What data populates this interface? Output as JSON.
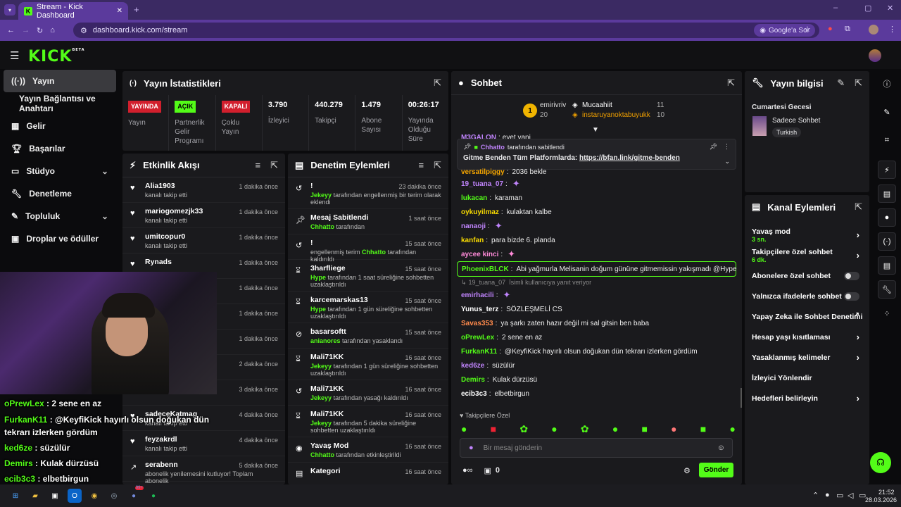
{
  "browser": {
    "tab_title": "Stream - Kick Dashboard",
    "url": "dashboard.kick.com/stream",
    "google_btn": "Google'a Sor"
  },
  "brand": {
    "logo": "KICK",
    "beta": "BETA",
    "accent": "#53fc18"
  },
  "sidebar": {
    "items": [
      {
        "label": "Yayın"
      },
      {
        "label": "Yayın Bağlantısı ve Anahtarı"
      },
      {
        "label": "Gelir"
      },
      {
        "label": "Başarılar"
      },
      {
        "label": "Stüdyo"
      },
      {
        "label": "Denetleme"
      },
      {
        "label": "Topluluk"
      },
      {
        "label": "Droplar ve ödüller"
      }
    ]
  },
  "stats": {
    "title": "Yayın İstatistikleri",
    "cells": [
      {
        "tag": "YAYINDA",
        "label": "Yayın"
      },
      {
        "tag": "AÇIK",
        "label": "Partnerlik Gelir Programı"
      },
      {
        "tag": "KAPALI",
        "label": "Çoklu Yayın"
      },
      {
        "value": "3.790",
        "label": "İzleyici"
      },
      {
        "value": "440.279",
        "label": "Takipçi"
      },
      {
        "value": "1.479",
        "label": "Abone Sayısı"
      },
      {
        "value": "00:26:17",
        "label": "Yayında Olduğu Süre"
      }
    ]
  },
  "activity": {
    "title": "Etkinlik Akışı",
    "items": [
      {
        "name": "Alia1903",
        "sub": "kanalı takip etti",
        "time": "1 dakika önce"
      },
      {
        "name": "mariogomezjk33",
        "sub": "kanalı takip etti",
        "time": "1 dakika önce"
      },
      {
        "name": "umitcopur0",
        "sub": "kanalı takip etti",
        "time": "1 dakika önce"
      },
      {
        "name": "Rynads",
        "sub": "",
        "time": "1 dakika önce"
      },
      {
        "name": "",
        "sub": "",
        "time": "1 dakika önce"
      },
      {
        "name": "",
        "sub": "",
        "time": "1 dakika önce"
      },
      {
        "name": "",
        "sub": "",
        "time": "1 dakika önce"
      },
      {
        "name": "",
        "sub": "",
        "time": "2 dakika önce"
      },
      {
        "name": "",
        "sub": "kanalı takip etti",
        "time": "3 dakika önce"
      },
      {
        "name": "sadeceKatmag",
        "sub": "kanalı takip etti",
        "time": "4 dakika önce"
      },
      {
        "name": "feyzakrdl",
        "sub": "kanalı takip etti",
        "time": "4 dakika önce"
      },
      {
        "name": "serabenn",
        "sub": "abonelik yenilemesini kutluyor! Toplam abonelik",
        "time": "5 dakika önce"
      }
    ]
  },
  "moderation": {
    "title": "Denetim Eylemleri",
    "items": [
      {
        "name": "!",
        "hl": "Jekeyy",
        "sub": "tarafından engellenmiş bir terim olarak eklendi",
        "time": "23 dakika önce"
      },
      {
        "name": "Mesaj Sabitlendi",
        "hl": "Chhatto",
        "sub": "tarafından",
        "time": "1 saat önce"
      },
      {
        "name": "!",
        "hl": "Chhatto",
        "pre": "engellenmiş terim",
        "sub": "tarafından kaldırıldı",
        "time": "15 saat önce"
      },
      {
        "name": "3harfliege",
        "hl": "Hype",
        "sub": "tarafından 1 saat süreliğine sohbetten uzaklaştırıldı",
        "time": "15 saat önce"
      },
      {
        "name": "karcemarskas13",
        "hl": "Hype",
        "sub": "tarafından 1 gün süreliğine sohbetten uzaklaştırıldı",
        "time": "15 saat önce"
      },
      {
        "name": "basarsoftt",
        "hl": "anianores",
        "sub": "tarafından yasaklandı",
        "time": "15 saat önce"
      },
      {
        "name": "Mali71KK",
        "hl": "Jekeyy",
        "sub": "tarafından 1 gün süreliğine sohbetten uzaklaştırıldı",
        "time": "16 saat önce"
      },
      {
        "name": "Mali71KK",
        "hl": "Jekeyy",
        "sub": "tarafından yasağı kaldırıldı",
        "time": "16 saat önce"
      },
      {
        "name": "Mali71KK",
        "hl": "Jekeyy",
        "sub": "tarafından 5 dakika süreliğine sohbetten uzaklaştırıldı",
        "time": "16 saat önce"
      },
      {
        "name": "Yavaş Mod",
        "hl": "Chhatto",
        "sub": "tarafından etkinleştirildi",
        "time": "16 saat önce"
      },
      {
        "name": "Kategori",
        "hl": "",
        "sub": "",
        "time": "16 saat önce"
      }
    ]
  },
  "chat": {
    "title": "Sohbet",
    "top": [
      {
        "rank": "1",
        "name": "emirivriv",
        "count": "20"
      },
      {
        "name": "Mucaahiit",
        "count": "11"
      },
      {
        "name": "instaruyanoktabuyukk",
        "count": "10"
      }
    ],
    "first_line": {
      "user": "M3GALON",
      "text": "evet yani"
    },
    "pinned": {
      "by": "Chhatto",
      "by_suffix": "tarafından sabitlendi",
      "text": "Gitme Benden Tüm Platformlarda:",
      "link": "https://bfan.link/gitme-benden"
    },
    "messages": [
      {
        "user": "versatilpiggy",
        "text": "2036 bekle",
        "color": "#f7a700"
      },
      {
        "user": "19_tuana_07",
        "text": "",
        "color": "#c084fc"
      },
      {
        "user": "lukacan",
        "text": "karaman",
        "color": "#53fc18"
      },
      {
        "user": "oykuyilmaz",
        "text": "kulaktan kalbe",
        "color": "#f7d900"
      },
      {
        "user": "nanaoji",
        "text": "",
        "color": "#c084fc"
      },
      {
        "user": "kanfan",
        "text": "para bizde 6. planda",
        "color": "#f7d900"
      },
      {
        "user": "aycee kinci",
        "text": "",
        "color": "#ff8ad8"
      },
      {
        "user": "PhoenixBLCK",
        "text": "Abi yağmurla Melisanin doğum gününe gitmemissin yakışmadı @Hype",
        "color": "#53fc18",
        "highlight": true
      },
      {
        "user": "19_tuana_07",
        "text": "İsimli kullanıcıya yanıt veriyor",
        "color": "#888",
        "reply": true
      },
      {
        "user": "emirhacili",
        "text": "",
        "color": "#c084fc"
      },
      {
        "user": "Yunus_terz",
        "text": "SÖZLEŞMELİ CS",
        "color": "#ffffff"
      },
      {
        "user": "Savas353",
        "text": "ya şarkı zaten hazır değil mi sal gitsin ben baba",
        "color": "#ff8a4c"
      },
      {
        "user": "oPrewLex",
        "text": "2 sene en az",
        "color": "#53fc18"
      },
      {
        "user": "FurkanK11",
        "text": "@KeyfiKick hayırlı olsun doğukan dün tekrarı izlerken gördüm",
        "color": "#53fc18"
      },
      {
        "user": "ked6ze",
        "text": "süzülür",
        "color": "#c084fc"
      },
      {
        "user": "Demirs",
        "text": "Kulak dürzüsü",
        "color": "#53fc18"
      },
      {
        "user": "ecib3c3",
        "text": "elbetbirgun",
        "color": "#ffffff"
      }
    ],
    "followers_only": "Takipçilere Özel",
    "input_placeholder": "Bir mesaj gönderin",
    "send": "Gönder",
    "count": "0"
  },
  "info": {
    "title": "Yayın bilgisi",
    "stream_title": "Cumartesi Gecesi",
    "category": "Sadece Sohbet",
    "language": "Turkish"
  },
  "actions": {
    "title": "Kanal Eylemleri",
    "items": [
      {
        "label": "Yavaş mod",
        "sub": "3 sn.",
        "type": "arrow"
      },
      {
        "label": "Takipçilere özel sohbet",
        "sub": "6 dk.",
        "type": "arrow"
      },
      {
        "label": "Abonelere özel sohbet",
        "sub": "",
        "type": "toggle"
      },
      {
        "label": "Yalnızca ifadelerle sohbet",
        "sub": "",
        "type": "toggle"
      },
      {
        "label": "Yapay Zeka ile Sohbet Denetimi",
        "sub": "",
        "type": "ext"
      },
      {
        "label": "Hesap yaşı kısıtlaması",
        "sub": "",
        "type": "arrow"
      },
      {
        "label": "Yasaklanmış kelimeler",
        "sub": "",
        "type": "arrow"
      },
      {
        "label": "İzleyici Yönlendir",
        "sub": "",
        "type": "none"
      },
      {
        "label": "Hedefleri belirleyin",
        "sub": "",
        "type": "arrow"
      }
    ]
  },
  "overlay": {
    "lines": [
      {
        "user": "oPrewLex",
        "text": " : 2 sene en az"
      },
      {
        "user": "FurkanK11",
        "text": " : @KeyfiKick hayırlı olsun doğukan dün"
      },
      {
        "user": "",
        "text": "tekrarı izlerken gördüm"
      },
      {
        "user": "ked6ze",
        "text": " : süzülür"
      },
      {
        "user": "Demirs",
        "text": " : Kulak dürzüsü"
      },
      {
        "user": "ecib3c3",
        "text": " : elbetbirgun"
      }
    ]
  },
  "taskbar": {
    "time": "21:52",
    "date": "28.03.2026",
    "badge": "99+"
  }
}
